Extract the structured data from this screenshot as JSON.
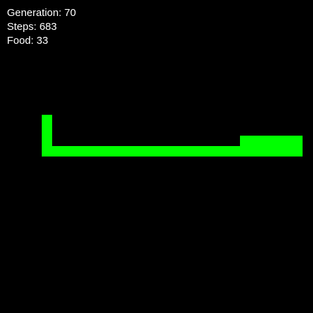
{
  "hud": {
    "generation_label": "Generation: 70",
    "steps_label": "Steps: 683",
    "food_label": "Food: 33"
  },
  "colors": {
    "background": "#000000",
    "snake": "#00ff00",
    "text": "#ffffff"
  },
  "snake": {
    "segments": [
      [
        4,
        11
      ],
      [
        4,
        12
      ],
      [
        4,
        14
      ],
      [
        5,
        14
      ],
      [
        6,
        14
      ],
      [
        7,
        14
      ],
      [
        8,
        14
      ],
      [
        9,
        14
      ],
      [
        10,
        14
      ],
      [
        11,
        14
      ],
      [
        12,
        14
      ],
      [
        13,
        14
      ],
      [
        14,
        14
      ],
      [
        15,
        14
      ],
      [
        16,
        14
      ],
      [
        17,
        14
      ],
      [
        18,
        14
      ],
      [
        19,
        14
      ],
      [
        20,
        14
      ],
      [
        21,
        14
      ],
      [
        22,
        14
      ],
      [
        23,
        14
      ],
      [
        23,
        13
      ],
      [
        24,
        13
      ],
      [
        24,
        14
      ],
      [
        25,
        13
      ],
      [
        25,
        14
      ],
      [
        26,
        13
      ],
      [
        26,
        14
      ],
      [
        27,
        13
      ],
      [
        27,
        14
      ],
      [
        28,
        13
      ],
      [
        28,
        14
      ],
      [
        4,
        13
      ]
    ]
  }
}
